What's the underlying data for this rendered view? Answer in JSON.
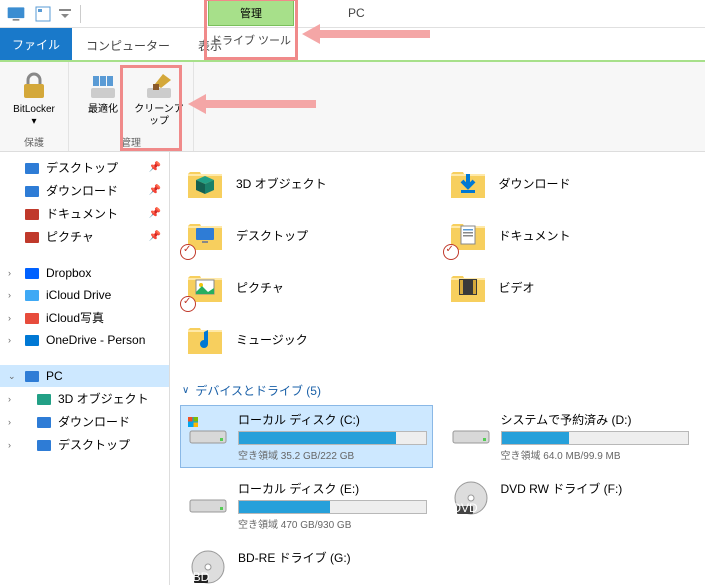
{
  "titlebar": {
    "app_location": "PC"
  },
  "tabs": {
    "file": "ファイル",
    "computer": "コンピューター",
    "view": "表示",
    "context_header": "管理",
    "context_tab": "ドライブ ツール"
  },
  "ribbon": {
    "bitlocker": "BitLocker",
    "optimize": "最適化",
    "cleanup": "クリーンアップ",
    "group_protect": "保護",
    "group_manage": "管理"
  },
  "nav": {
    "quick": [
      {
        "label": "デスクトップ",
        "icon": "desktop",
        "pinned": true
      },
      {
        "label": "ダウンロード",
        "icon": "download",
        "pinned": true
      },
      {
        "label": "ドキュメント",
        "icon": "document",
        "pinned": true
      },
      {
        "label": "ピクチャ",
        "icon": "picture",
        "pinned": true
      }
    ],
    "cloud": [
      {
        "label": "Dropbox",
        "icon": "dropbox"
      },
      {
        "label": "iCloud Drive",
        "icon": "icloud"
      },
      {
        "label": "iCloud写真",
        "icon": "icloud-photo"
      },
      {
        "label": "OneDrive - Person",
        "icon": "onedrive"
      }
    ],
    "pc": {
      "label": "PC",
      "children": [
        {
          "label": "3D オブジェクト",
          "icon": "3d"
        },
        {
          "label": "ダウンロード",
          "icon": "download"
        },
        {
          "label": "デスクトップ",
          "icon": "desktop"
        }
      ]
    }
  },
  "content": {
    "folders": [
      {
        "label": "3D オブジェクト",
        "icon": "3d",
        "badge": false
      },
      {
        "label": "ダウンロード",
        "icon": "download",
        "badge": false
      },
      {
        "label": "デスクトップ",
        "icon": "desktop",
        "badge": true
      },
      {
        "label": "ドキュメント",
        "icon": "document",
        "badge": true
      },
      {
        "label": "ピクチャ",
        "icon": "picture",
        "badge": true
      },
      {
        "label": "ビデオ",
        "icon": "video",
        "badge": false
      },
      {
        "label": "ミュージック",
        "icon": "music",
        "badge": false
      }
    ],
    "group_header": "デバイスとドライブ (5)",
    "drives": [
      {
        "name": "ローカル ディスク (C:)",
        "free_text": "空き領域 35.2 GB/222 GB",
        "fill_pct": 84,
        "type": "hdd",
        "os": true,
        "selected": true
      },
      {
        "name": "システムで予約済み (D:)",
        "free_text": "空き領域 64.0 MB/99.9 MB",
        "fill_pct": 36,
        "type": "hdd",
        "os": false,
        "selected": false
      },
      {
        "name": "ローカル ディスク (E:)",
        "free_text": "空き領域 470 GB/930 GB",
        "fill_pct": 49,
        "type": "hdd",
        "os": false,
        "selected": false
      },
      {
        "name": "DVD RW ドライブ (F:)",
        "free_text": "",
        "fill_pct": 0,
        "type": "dvd",
        "os": false,
        "selected": false
      },
      {
        "name": "BD-RE ドライブ (G:)",
        "free_text": "",
        "fill_pct": 0,
        "type": "bd",
        "os": false,
        "selected": false
      }
    ]
  }
}
